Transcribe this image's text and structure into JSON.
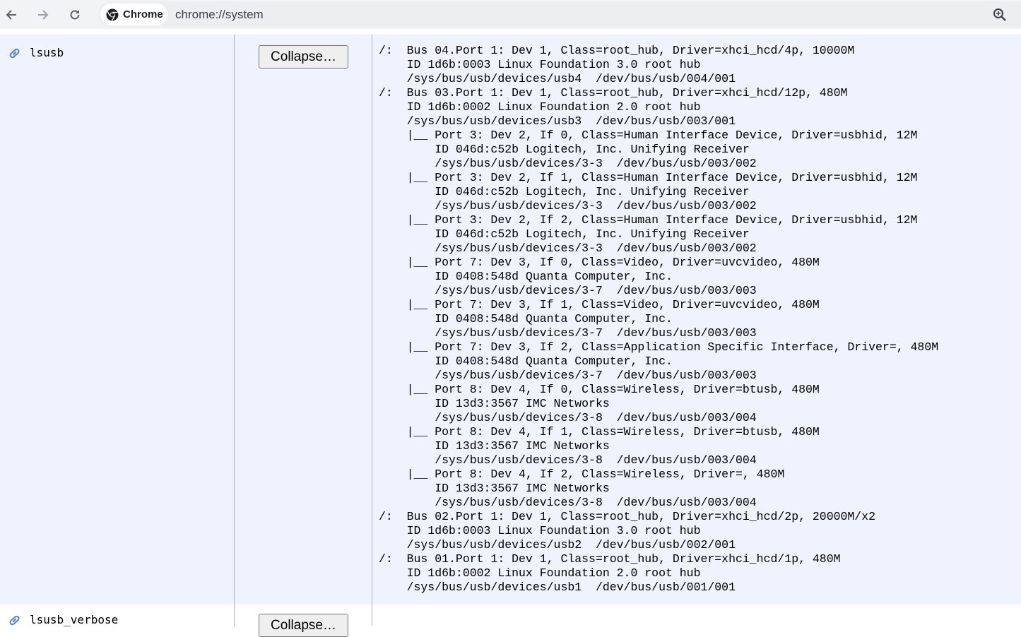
{
  "browser": {
    "chip_label": "Chrome",
    "url": "chrome://system"
  },
  "rows": [
    {
      "name": "lsusb",
      "button_label": "Collapse…",
      "value_lines": [
        "/:  Bus 04.Port 1: Dev 1, Class=root_hub, Driver=xhci_hcd/4p, 10000M",
        "    ID 1d6b:0003 Linux Foundation 3.0 root hub",
        "    /sys/bus/usb/devices/usb4  /dev/bus/usb/004/001",
        "/:  Bus 03.Port 1: Dev 1, Class=root_hub, Driver=xhci_hcd/12p, 480M",
        "    ID 1d6b:0002 Linux Foundation 2.0 root hub",
        "    /sys/bus/usb/devices/usb3  /dev/bus/usb/003/001",
        "    |__ Port 3: Dev 2, If 0, Class=Human Interface Device, Driver=usbhid, 12M",
        "        ID 046d:c52b Logitech, Inc. Unifying Receiver",
        "        /sys/bus/usb/devices/3-3  /dev/bus/usb/003/002",
        "    |__ Port 3: Dev 2, If 1, Class=Human Interface Device, Driver=usbhid, 12M",
        "        ID 046d:c52b Logitech, Inc. Unifying Receiver",
        "        /sys/bus/usb/devices/3-3  /dev/bus/usb/003/002",
        "    |__ Port 3: Dev 2, If 2, Class=Human Interface Device, Driver=usbhid, 12M",
        "        ID 046d:c52b Logitech, Inc. Unifying Receiver",
        "        /sys/bus/usb/devices/3-3  /dev/bus/usb/003/002",
        "    |__ Port 7: Dev 3, If 0, Class=Video, Driver=uvcvideo, 480M",
        "        ID 0408:548d Quanta Computer, Inc.",
        "        /sys/bus/usb/devices/3-7  /dev/bus/usb/003/003",
        "    |__ Port 7: Dev 3, If 1, Class=Video, Driver=uvcvideo, 480M",
        "        ID 0408:548d Quanta Computer, Inc.",
        "        /sys/bus/usb/devices/3-7  /dev/bus/usb/003/003",
        "    |__ Port 7: Dev 3, If 2, Class=Application Specific Interface, Driver=, 480M",
        "        ID 0408:548d Quanta Computer, Inc.",
        "        /sys/bus/usb/devices/3-7  /dev/bus/usb/003/003",
        "    |__ Port 8: Dev 4, If 0, Class=Wireless, Driver=btusb, 480M",
        "        ID 13d3:3567 IMC Networks",
        "        /sys/bus/usb/devices/3-8  /dev/bus/usb/003/004",
        "    |__ Port 8: Dev 4, If 1, Class=Wireless, Driver=btusb, 480M",
        "        ID 13d3:3567 IMC Networks",
        "        /sys/bus/usb/devices/3-8  /dev/bus/usb/003/004",
        "    |__ Port 8: Dev 4, If 2, Class=Wireless, Driver=, 480M",
        "        ID 13d3:3567 IMC Networks",
        "        /sys/bus/usb/devices/3-8  /dev/bus/usb/003/004",
        "/:  Bus 02.Port 1: Dev 1, Class=root_hub, Driver=xhci_hcd/2p, 20000M/x2",
        "    ID 1d6b:0003 Linux Foundation 3.0 root hub",
        "    /sys/bus/usb/devices/usb2  /dev/bus/usb/002/001",
        "/:  Bus 01.Port 1: Dev 1, Class=root_hub, Driver=xhci_hcd/1p, 480M",
        "    ID 1d6b:0002 Linux Foundation 2.0 root hub",
        "    /sys/bus/usb/devices/usb1  /dev/bus/usb/001/001"
      ]
    },
    {
      "name": "lsusb_verbose",
      "button_label": "Collapse…"
    }
  ],
  "colors": {
    "toolbar_bg": "#f1f3f4",
    "row_bg": "#eef3fd",
    "link_icon": "#5f87c6"
  }
}
